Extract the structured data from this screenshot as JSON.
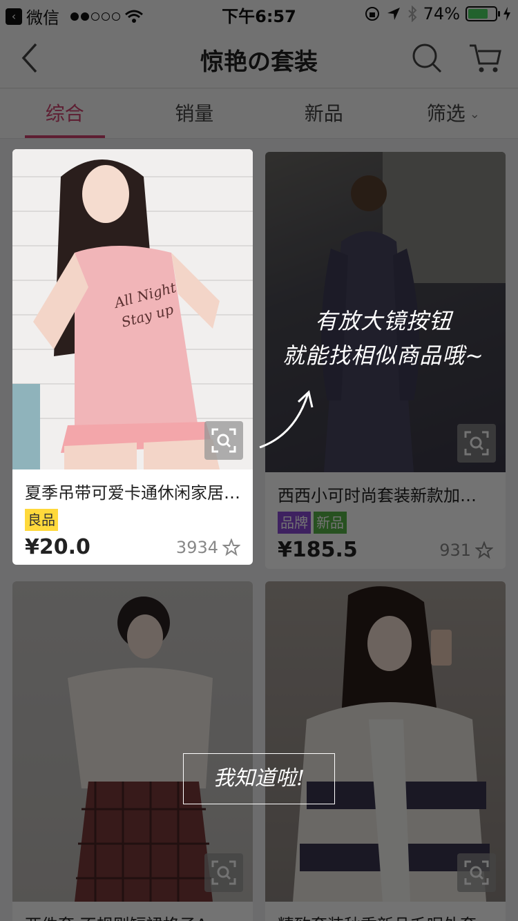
{
  "status_bar": {
    "app_back_label": "微信",
    "time": "下午6:57",
    "battery": "74%"
  },
  "nav": {
    "title": "惊艳の套装"
  },
  "tabs": [
    {
      "label": "综合",
      "active": true
    },
    {
      "label": "销量",
      "active": false
    },
    {
      "label": "新品",
      "active": false
    },
    {
      "label": "筛选",
      "active": false
    }
  ],
  "products": [
    {
      "title": "夏季吊带可爱卡通休闲家居…",
      "badges": [
        "良品"
      ],
      "price": "¥20.0",
      "likes": "3934"
    },
    {
      "title": "西西小可时尚套装新款加…",
      "badges": [
        "品牌",
        "新品"
      ],
      "price": "¥185.5",
      "likes": "931"
    },
    {
      "title": "两件套 不规则短裙格子A…",
      "badges": [],
      "price": "",
      "likes": ""
    },
    {
      "title": "精致套装秋季新品毛呢外套…",
      "badges": [],
      "price": "",
      "likes": ""
    }
  ],
  "guide": {
    "tip_line1": "有放大镜按钮",
    "tip_line2": "就能找相似商品哦~",
    "dismiss_label": "我知道啦!"
  },
  "colors": {
    "accent": "#d14470",
    "badge_good": "#ffd93b",
    "badge_brand": "#8a4bd6",
    "badge_new": "#58b347"
  },
  "icons": [
    "back-arrow-icon",
    "search-icon",
    "cart-icon",
    "chevron-down-icon",
    "zoom-search-icon",
    "star-icon"
  ]
}
